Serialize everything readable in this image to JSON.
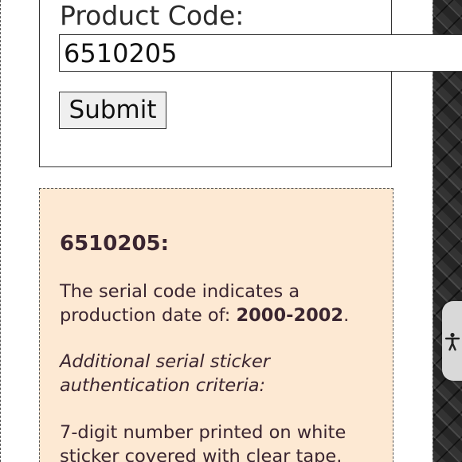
{
  "form": {
    "label": "Product Code:",
    "input_value": "6510205",
    "submit_label": "Submit"
  },
  "result": {
    "title": "6510205:",
    "date_text_prefix": "The serial code indicates a production date of: ",
    "date_value": "2000-2002",
    "date_text_suffix": ".",
    "criteria_heading": "Additional serial sticker authentication criteria:",
    "criteria_text": "7-digit number printed on white sticker covered with clear tape."
  },
  "accessibility": {
    "icon": "accessibility-icon"
  },
  "colors": {
    "result_background": "#fde9d3",
    "result_text": "#3a2530"
  }
}
